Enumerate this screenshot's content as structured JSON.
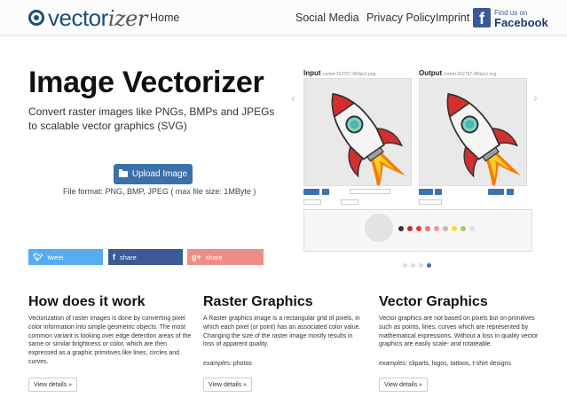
{
  "brand": {
    "logo_main": "vector",
    "logo_accent": "izer",
    "logo_icon": "target-icon"
  },
  "nav": {
    "home": "Home",
    "social": "Social Media",
    "privacy": "Privacy Policy",
    "imprint": "Imprint",
    "facebook_small": "Find us on",
    "facebook_big": "Facebook"
  },
  "hero": {
    "title": "Image Vectorizer",
    "subtitle": "Convert raster images like PNGs, BMPs and JPEGs to scalable vector graphics (SVG)",
    "upload_label": "Upload Image",
    "format_note": "File format: PNG, BMP, JPEG ( max file size: 1MByte )"
  },
  "share": {
    "twitter": "tweet",
    "facebook": "share",
    "google": "share"
  },
  "preview": {
    "input_label": "Input",
    "input_file": "rocket-312767-960px1.png",
    "output_label": "Output",
    "output_file": "rocket-312767-960px1.svg",
    "swatch_colors": [
      "#333333",
      "#c62828",
      "#e53935",
      "#e57373",
      "#ef9a9a",
      "#bdbdbd",
      "#fdd835",
      "#9ccc65",
      "#e0e0e0"
    ],
    "slide_index": 4,
    "slide_count": 4
  },
  "features": [
    {
      "title": "How does it work",
      "text": "Vectorization of raster images is done by converting pixel color information into simple geometric objects. The most common variant is looking over edge detection areas of the same or similar brightness or color, which are then expressed as a graphic primitives like lines, circles and curves.",
      "examples_label": "",
      "examples": "",
      "button": "View details »"
    },
    {
      "title": "Raster Graphics",
      "text": "A Raster graphics image is a rectangular grid of pixels, in which each pixel (or point) has an associated color value. Changing the size of the raster image mostly results in loss of apparent quality.",
      "examples_label": "examples:",
      "examples": " photos",
      "button": "View details »"
    },
    {
      "title": "Vector Graphics",
      "text": "Vector graphics are not based on pixels but on primitives such as points, lines, curves which are represented by mathematical expressions. Without a loss in quality vector graphics are easily scale- and rotateable.",
      "examples_label": "examples:",
      "examples": " cliparts, logos, tattoos, t-shirt designs",
      "button": "View details »"
    }
  ],
  "colors": {
    "brand_blue": "#1d4e7b",
    "button_blue": "#3b70ab",
    "twitter": "#56acee",
    "facebook": "#3b5a96",
    "google": "#ee8d85"
  }
}
